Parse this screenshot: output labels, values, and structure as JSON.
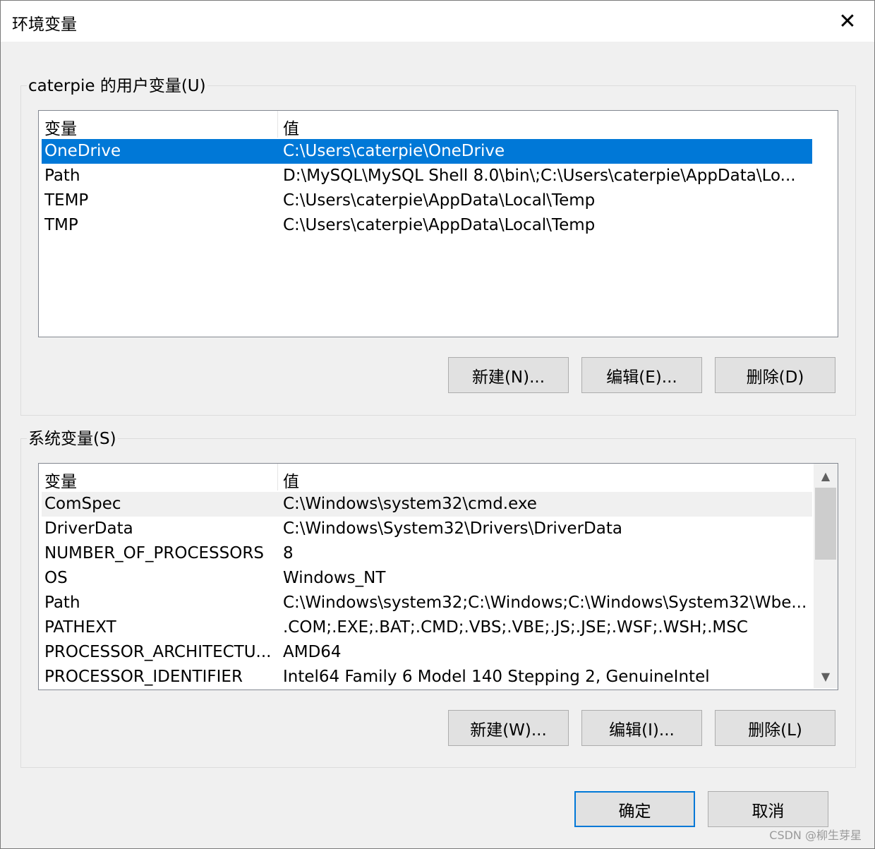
{
  "window": {
    "title": "环境变量",
    "close_glyph": "✕"
  },
  "user_vars": {
    "group_title": "caterpie 的用户变量(U)",
    "columns": [
      "变量",
      "值"
    ],
    "rows": [
      {
        "name": "OneDrive",
        "value": "C:\\Users\\caterpie\\OneDrive"
      },
      {
        "name": "Path",
        "value": "D:\\MySQL\\MySQL Shell 8.0\\bin\\;C:\\Users\\caterpie\\AppData\\Lo..."
      },
      {
        "name": "TEMP",
        "value": "C:\\Users\\caterpie\\AppData\\Local\\Temp"
      },
      {
        "name": "TMP",
        "value": "C:\\Users\\caterpie\\AppData\\Local\\Temp"
      }
    ],
    "selected_index": 0,
    "buttons": {
      "new": "新建(N)...",
      "edit": "编辑(E)...",
      "delete": "删除(D)"
    }
  },
  "system_vars": {
    "group_title": "系统变量(S)",
    "columns": [
      "变量",
      "值"
    ],
    "rows": [
      {
        "name": "ComSpec",
        "value": "C:\\Windows\\system32\\cmd.exe"
      },
      {
        "name": "DriverData",
        "value": "C:\\Windows\\System32\\Drivers\\DriverData"
      },
      {
        "name": "NUMBER_OF_PROCESSORS",
        "value": "8"
      },
      {
        "name": "OS",
        "value": "Windows_NT"
      },
      {
        "name": "Path",
        "value": "C:\\Windows\\system32;C:\\Windows;C:\\Windows\\System32\\Wbe..."
      },
      {
        "name": "PATHEXT",
        "value": ".COM;.EXE;.BAT;.CMD;.VBS;.VBE;.JS;.JSE;.WSF;.WSH;.MSC"
      },
      {
        "name": "PROCESSOR_ARCHITECTU...",
        "value": "AMD64"
      },
      {
        "name": "PROCESSOR_IDENTIFIER",
        "value": "Intel64 Family 6 Model 140 Stepping 2, GenuineIntel"
      }
    ],
    "hover_index": 0,
    "scroll_up_glyph": "▲",
    "scroll_down_glyph": "▼",
    "buttons": {
      "new": "新建(W)...",
      "edit": "编辑(I)...",
      "delete": "删除(L)"
    }
  },
  "footer": {
    "ok": "确定",
    "cancel": "取消",
    "watermark": "CSDN @柳生芽星"
  }
}
